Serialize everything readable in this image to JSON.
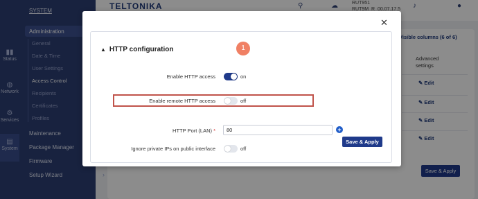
{
  "rail": {
    "items": [
      {
        "label": "Status",
        "icon": "status-icon"
      },
      {
        "label": "Network",
        "icon": "network-icon"
      },
      {
        "label": "Services",
        "icon": "services-icon"
      },
      {
        "label": "System",
        "icon": "system-icon"
      }
    ]
  },
  "menu": {
    "section": "SYSTEM",
    "administration": "Administration",
    "sub_items": [
      "General",
      "Date & Time",
      "User Settings",
      "Access Control",
      "Recipients",
      "Certificates",
      "Profiles"
    ],
    "top_items": [
      "Maintenance",
      "Package Manager",
      "Firmware",
      "Setup Wizard"
    ]
  },
  "header": {
    "logo": "TELTONIKA",
    "device_line1": "RUT951",
    "device_line2": "RUT9M_R_00.07.17.5"
  },
  "background": {
    "visible_columns": "Visible columns (6 of 6)",
    "advanced_line1": "Advanced",
    "advanced_line2": "settings",
    "edit_label": "Edit",
    "save_apply": "Save & Apply"
  },
  "modal": {
    "section_title": "HTTP configuration",
    "badge": "1",
    "fields": {
      "enable_http": {
        "label": "Enable HTTP access",
        "state": "on"
      },
      "enable_remote_http": {
        "label": "Enable remote HTTP access",
        "state": "off"
      },
      "http_port": {
        "label": "HTTP Port (LAN)",
        "required_mark": "*",
        "value": "80"
      },
      "ignore_private": {
        "label": "Ignore private IPs on public interface",
        "state": "off"
      }
    },
    "save_apply": "Save & Apply"
  },
  "colors": {
    "primary": "#1f3a8a",
    "sidebar": "#2c3e73",
    "badge": "#f08064",
    "highlight": "#c0534a",
    "required": "#d62828"
  }
}
